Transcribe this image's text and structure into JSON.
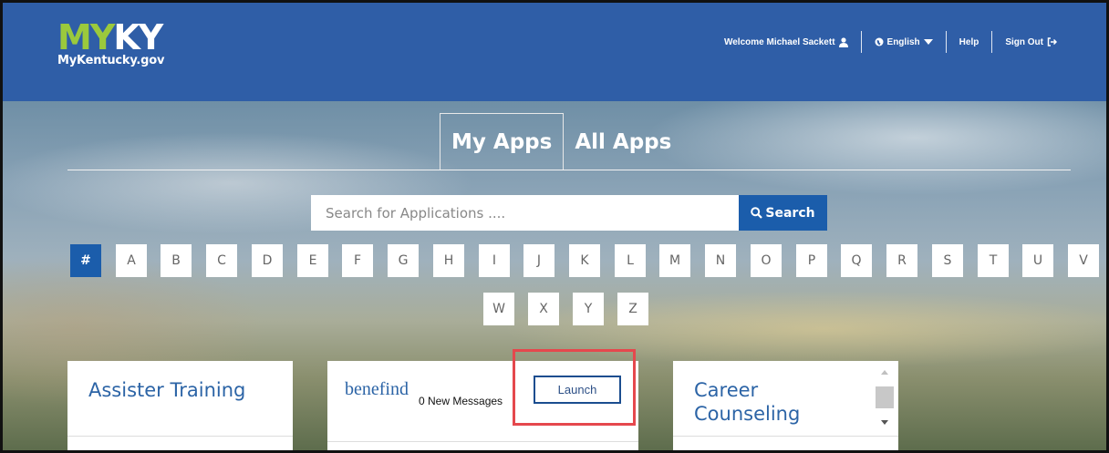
{
  "header": {
    "logo_my": "MY",
    "logo_ky": "KY",
    "logo_sub": "MyKentucky.gov",
    "welcome": "Welcome Michael Sackett",
    "language": "English",
    "help": "Help",
    "sign_out": "Sign Out"
  },
  "tabs": [
    {
      "label": "My Apps",
      "active": true
    },
    {
      "label": "All Apps",
      "active": false
    }
  ],
  "search": {
    "placeholder": "Search for Applications ....",
    "button": "Search"
  },
  "letters": [
    "#",
    "A",
    "B",
    "C",
    "D",
    "E",
    "F",
    "G",
    "H",
    "I",
    "J",
    "K",
    "L",
    "M",
    "N",
    "O",
    "P",
    "Q",
    "R",
    "S",
    "T",
    "U",
    "V",
    "W",
    "X",
    "Y",
    "Z"
  ],
  "active_letter": "#",
  "cards": {
    "assister": {
      "title": "Assister Training"
    },
    "benefind": {
      "logo": "benefind",
      "messages": "0 New Messages",
      "launch": "Launch"
    },
    "career": {
      "title_line1": "Career",
      "title_line2": "Counseling"
    }
  },
  "colors": {
    "header_bg": "#2f5ea7",
    "accent": "#1b5dab",
    "logo_green": "#9bc93c",
    "highlight": "#e5484d"
  }
}
